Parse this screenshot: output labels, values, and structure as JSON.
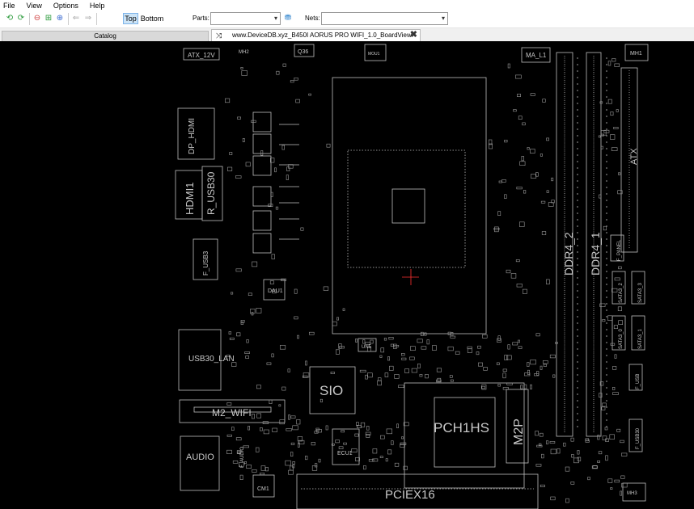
{
  "menu": {
    "file": "File",
    "view": "View",
    "options": "Options",
    "help": "Help"
  },
  "toolbar": {
    "top_label": "Top",
    "bottom_label": "Bottom",
    "parts_label": "Parts:",
    "nets_label": "Nets:",
    "parts_value": "",
    "nets_value": ""
  },
  "tabs": {
    "catalog": "Catalog",
    "document": "www.DeviceDB.xyz_B450I AORUS PRO WIFI_1.0_BoardView"
  },
  "board": {
    "labels": {
      "atx12v": "ATX_12V",
      "mh2": "MH2",
      "q36": "Q36",
      "mou1": "MOU1",
      "ma_l1": "MA_L1",
      "mh1": "MH1",
      "dp_hdmi": "DP_HDMI",
      "hdmi1": "HDMI1",
      "r_usb30": "R_USB30",
      "ddr4_2": "DDR4_2",
      "ddr4_1": "DDR4_1",
      "atx": "ATX",
      "f_usb3": "F_USB3",
      "dau1": "DAU1",
      "usb30_lan": "USB30_LAN",
      "un5": "UN5",
      "sio": "SIO",
      "pch1hs": "PCH1HS",
      "m2p": "M2P",
      "m2_wifi": "M2_WIFI",
      "audio": "AUDIO",
      "f_audio": "F_AUDIO",
      "ecu1": "ECU1",
      "cm1": "CM1",
      "pciex16": "PCIEX16",
      "f_panel": "F_PANEL",
      "sata3_0": "SATA3_0",
      "sata3_1": "SATA3_1",
      "sata3_2": "SATA3_2",
      "sata3_3": "SATA3_3",
      "f_usb": "F_USB",
      "f_usb30": "F_USB30",
      "mh3": "MH3"
    }
  },
  "colors": {
    "board_bg": "#000000",
    "outline": "#bfbfbf",
    "label": "#c8c8c8",
    "cursor": "#ff3030",
    "selected_button": "#cce4f7"
  }
}
